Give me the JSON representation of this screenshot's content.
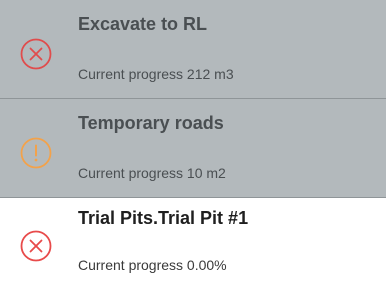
{
  "tasks": [
    {
      "title": "Excavate to RL",
      "progress": "Current progress 212 m3",
      "status_icon": "x-circle-icon",
      "icon_color": "#e04c4c",
      "highlighted": true
    },
    {
      "title": "Temporary roads",
      "progress": "Current progress 10 m2",
      "status_icon": "exclamation-circle-icon",
      "icon_color": "#f3a24a",
      "highlighted": true
    },
    {
      "title": "Trial Pits.Trial Pit #1",
      "progress": "Current progress 0.00%",
      "status_icon": "x-circle-icon",
      "icon_color": "#e84a4a",
      "highlighted": false
    }
  ],
  "colors": {
    "highlight_background": "#b3b9bc",
    "plain_background": "#ffffff",
    "divider": "#8f9598"
  }
}
